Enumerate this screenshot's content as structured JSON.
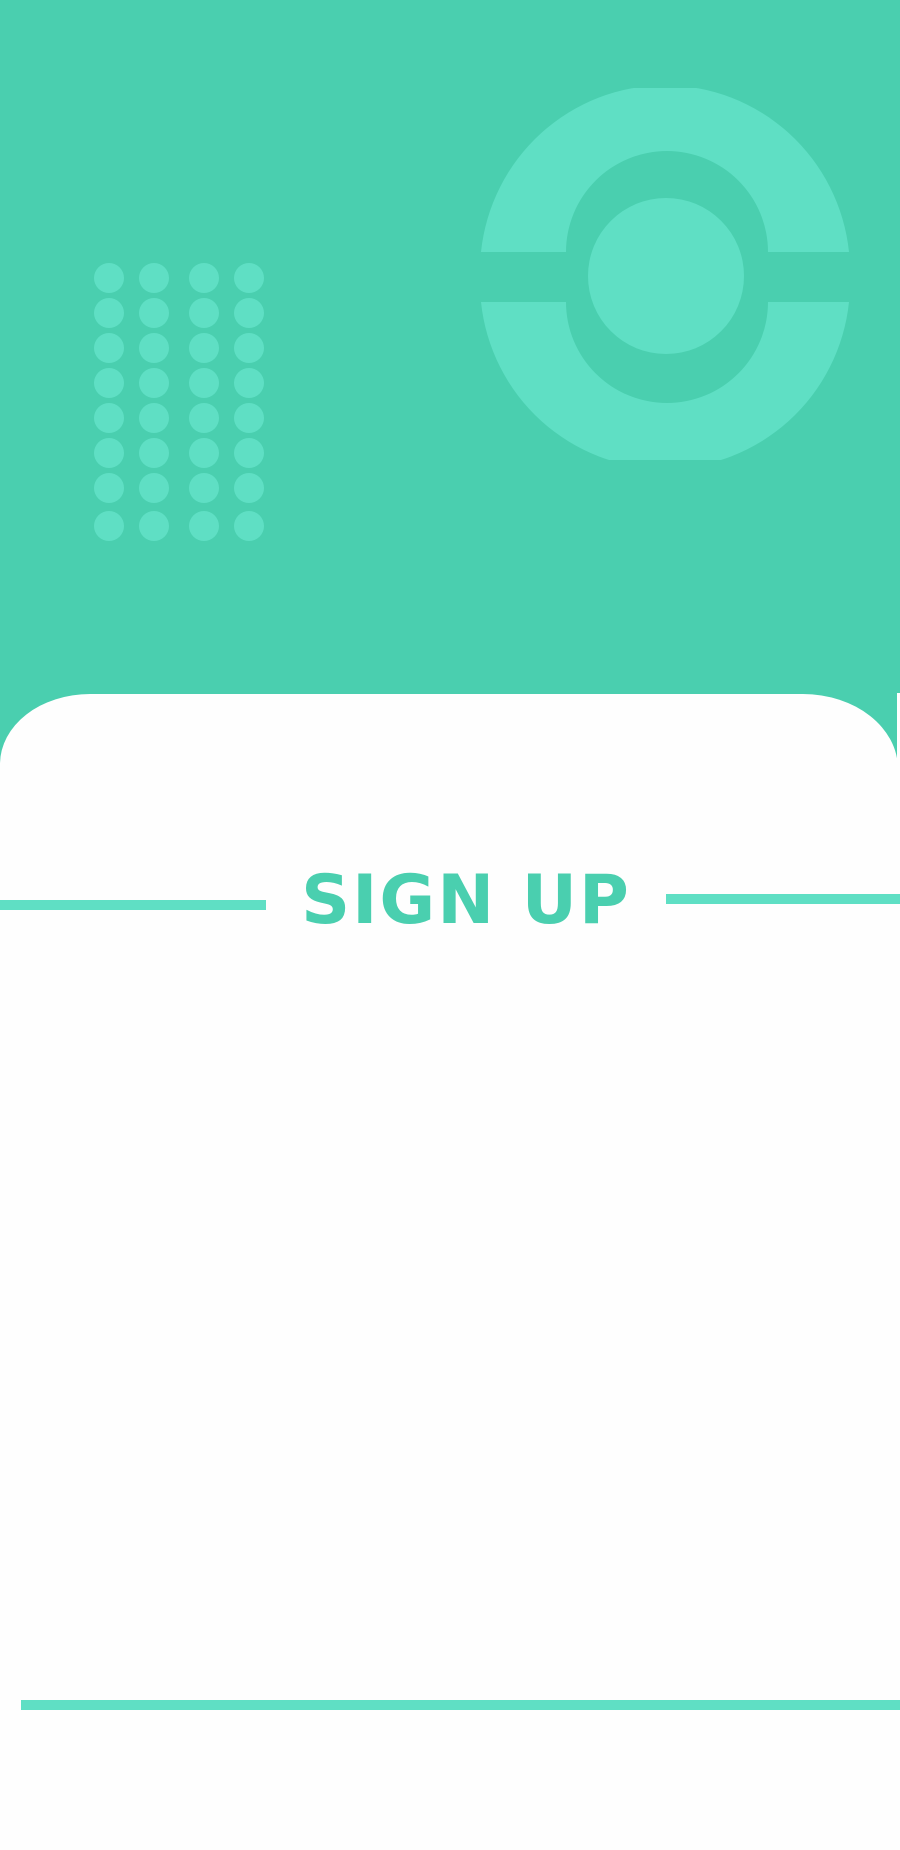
{
  "screen": {
    "title": "SIGN UP"
  },
  "colors": {
    "primary": "#4acfaf",
    "accent": "#5fdfc4",
    "card_background": "#fefefe"
  },
  "icons": {
    "logo": "ring-logo-icon",
    "pattern": "dot-pattern"
  }
}
